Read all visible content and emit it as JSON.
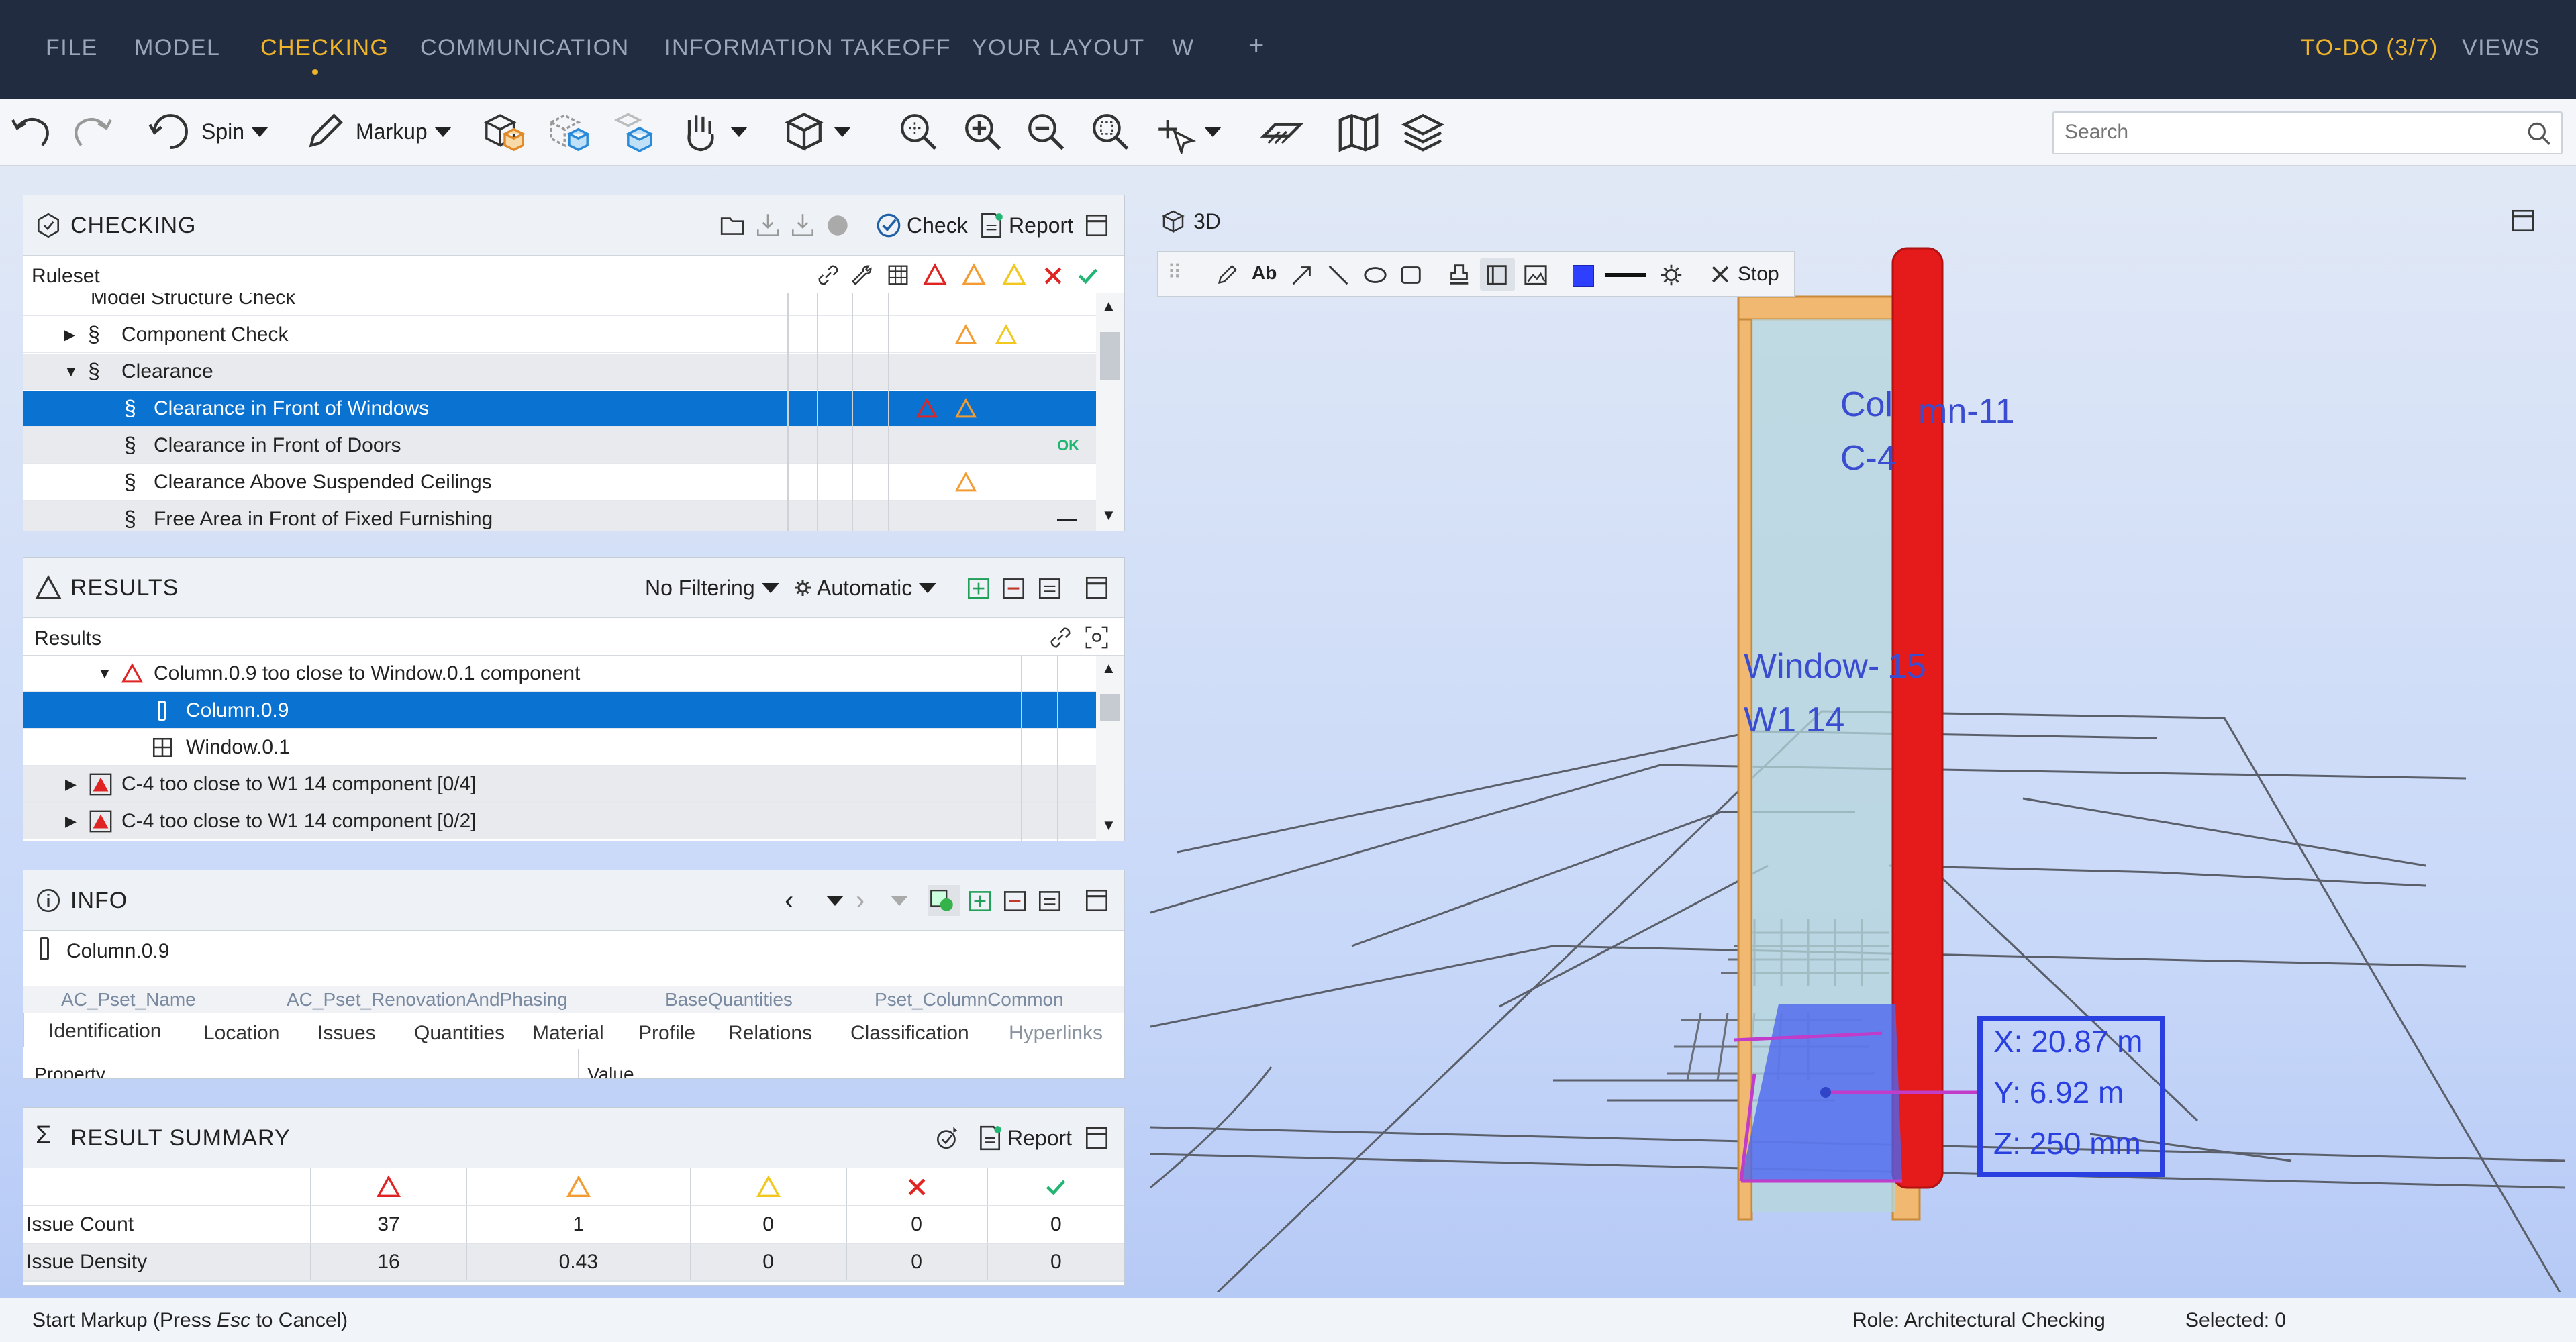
{
  "menu": {
    "file": "FILE",
    "model": "MODEL",
    "checking": "CHECKING",
    "communication": "COMMUNICATION",
    "information_takeoff": "INFORMATION TAKEOFF",
    "your_layout": "YOUR LAYOUT",
    "w": "W",
    "plus": "+",
    "todo": "TO-DO (3/7)",
    "views": "VIEWS"
  },
  "toolbar": {
    "spin": "Spin",
    "markup": "Markup",
    "search_placeholder": "Search"
  },
  "checking": {
    "title": "CHECKING",
    "check": "Check",
    "report": "Report",
    "column": "Ruleset",
    "rows": [
      {
        "label": "Model Structure Check"
      },
      {
        "label": "Component Check"
      },
      {
        "label": "Clearance"
      },
      {
        "label": "Clearance in Front of Windows"
      },
      {
        "label": "Clearance in Front of Doors",
        "status": "OK"
      },
      {
        "label": "Clearance Above Suspended Ceilings"
      },
      {
        "label": "Free Area in Front of Fixed Furnishing",
        "status": "—"
      }
    ]
  },
  "results": {
    "title": "RESULTS",
    "filter": "No Filtering",
    "mode": "Automatic",
    "column": "Results",
    "rows": [
      {
        "label": "Column.0.9 too close to Window.0.1 component"
      },
      {
        "label": "Column.0.9"
      },
      {
        "label": "Window.0.1"
      },
      {
        "label": "C-4 too close to W1 14 component [0/4]"
      },
      {
        "label": "C-4 too close to W1 14 component [0/2]"
      }
    ]
  },
  "info": {
    "title": "INFO",
    "object": "Column.0.9",
    "psets": [
      "AC_Pset_Name",
      "AC_Pset_RenovationAndPhasing",
      "BaseQuantities",
      "Pset_ColumnCommon"
    ],
    "tabs": [
      "Identification",
      "Location",
      "Issues",
      "Quantities",
      "Material",
      "Profile",
      "Relations",
      "Classification",
      "Hyperlinks"
    ],
    "prop_col": "Property",
    "val_col": "Value"
  },
  "summary": {
    "title": "RESULT SUMMARY",
    "report": "Report",
    "rows": [
      {
        "label": "Issue Count",
        "values": [
          "37",
          "1",
          "0",
          "0",
          "0"
        ]
      },
      {
        "label": "Issue Density",
        "values": [
          "16",
          "0.43",
          "0",
          "0",
          "0"
        ]
      }
    ]
  },
  "view3d": {
    "title": "3D",
    "stop": "Stop",
    "labels": {
      "col_a": "Col",
      "col_b": "mn-11",
      "c4": "C-4",
      "win_a": "Window-",
      "win_b": "15",
      "w114": "W1 14"
    },
    "coords": {
      "x": "X: 20.87 m",
      "y": "Y: 6.92 m",
      "z": "Z: 250 mm"
    }
  },
  "status": {
    "hint_pre": "Start Markup (Press ",
    "hint_key": "Esc",
    "hint_post": " to Cancel)",
    "role": "Role: Architectural Checking",
    "selected": "Selected: 0"
  },
  "colors": {
    "accent": "#f0b429",
    "selection": "#0a72d1",
    "critical": "#e02424",
    "major": "#f39c33",
    "minor": "#f2c81e",
    "passed": "#22b573"
  }
}
